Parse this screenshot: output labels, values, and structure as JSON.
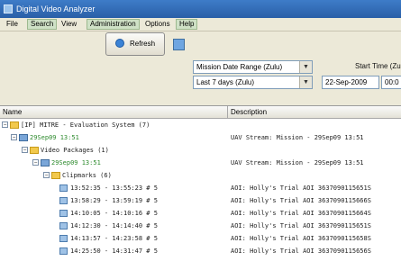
{
  "window": {
    "title": "Digital Video Analyzer"
  },
  "menu": [
    "File",
    "Search",
    "View",
    "Administration",
    "Options",
    "Help"
  ],
  "toolbar": {
    "refresh_label": "Refresh",
    "range_type": "Mission Date Range (Zulu)",
    "range_value": "Last 7 days (Zulu)",
    "start_label": "Start Time (Zu",
    "start_date": "22-Sep-2009",
    "start_time": "00:0"
  },
  "grid": {
    "col_name": "Name",
    "col_desc": "Description",
    "rows": [
      {
        "text": "[IP] MITRE - Evaluation System (7)",
        "desc": ""
      },
      {
        "text": "29Sep09 13:51",
        "desc": "UAV Stream: Mission - 29Sep09 13:51"
      },
      {
        "text": "Video Packages (1)",
        "desc": ""
      },
      {
        "text": "29Sep09 13:51",
        "desc": "UAV Stream: Mission - 29Sep09 13:51"
      },
      {
        "text": "Clipmarks (6)",
        "desc": ""
      },
      {
        "text": "13:52:35 - 13:55:23  #      5",
        "desc": "AOI: Holly's Trial AOI  3637090115651S"
      },
      {
        "text": "13:58:29 - 13:59:19  #      5",
        "desc": "AOI: Holly's Trial AOI  3637090115666S"
      },
      {
        "text": "14:10:05 - 14:10:16  #      5",
        "desc": "AOI: Holly's Trial AOI  3637090115664S"
      },
      {
        "text": "14:12:30 - 14:14:40  #      5",
        "desc": "AOI: Holly's Trial AOI  3637090115651S"
      },
      {
        "text": "14:13:57 - 14:23:58  #      5",
        "desc": "AOI: Holly's Trial AOI  3637090115658S"
      },
      {
        "text": "14:25:50 - 14:31:47  #      5",
        "desc": "AOI: Holly's Trial AOI  3637090115656S"
      }
    ]
  }
}
